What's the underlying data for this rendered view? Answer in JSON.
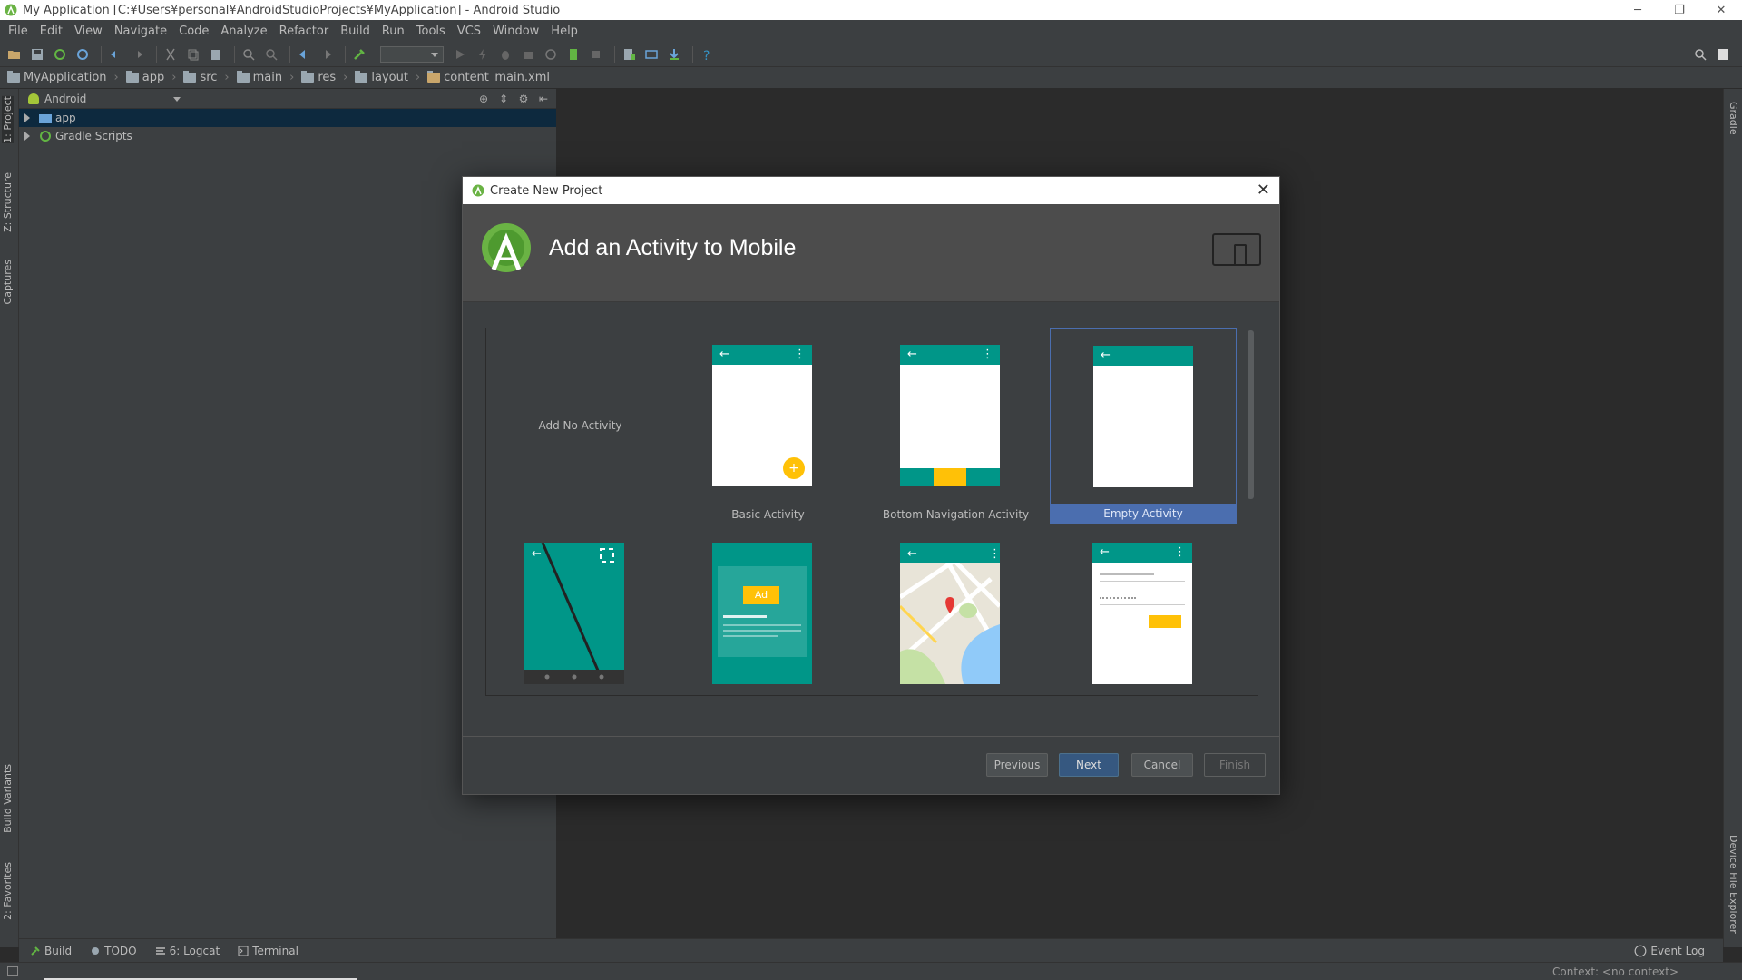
{
  "window": {
    "title": "My Application [C:¥Users¥personal¥AndroidStudioProjects¥MyApplication] - Android Studio",
    "minimize": "─",
    "restore": "❐",
    "close": "✕"
  },
  "menu": [
    "File",
    "Edit",
    "View",
    "Navigate",
    "Code",
    "Analyze",
    "Refactor",
    "Build",
    "Run",
    "Tools",
    "VCS",
    "Window",
    "Help"
  ],
  "breadcrumb": [
    "MyApplication",
    "app",
    "src",
    "main",
    "res",
    "layout",
    "content_main.xml"
  ],
  "left_tabs": [
    "1: Project",
    "Z: Structure",
    "Captures",
    "Build Variants",
    "2: Favorites"
  ],
  "right_tabs": [
    "Gradle",
    "Device File Explorer"
  ],
  "project_panel": {
    "view_selector": "Android",
    "tree": [
      {
        "label": "app",
        "selected": true
      },
      {
        "label": "Gradle Scripts",
        "selected": false
      }
    ]
  },
  "bottom_tabs": [
    "Build",
    "TODO",
    "6: Logcat",
    "Terminal"
  ],
  "event_log": "Event Log",
  "status": {
    "context": "Context: <no context>"
  },
  "dialog": {
    "title": "Create New Project",
    "heading": "Add an Activity to Mobile",
    "activities": [
      {
        "label": "Add No Activity",
        "selected": false
      },
      {
        "label": "Basic Activity",
        "selected": false
      },
      {
        "label": "Bottom Navigation Activity",
        "selected": false
      },
      {
        "label": "Empty Activity",
        "selected": true
      }
    ],
    "ad_label": "Ad",
    "buttons": {
      "previous": "Previous",
      "next": "Next",
      "cancel": "Cancel",
      "finish": "Finish"
    }
  },
  "colors": {
    "teal": "#009688",
    "amber": "#ffc107",
    "selection": "#4b6eaf",
    "primary_button": "#365880"
  }
}
